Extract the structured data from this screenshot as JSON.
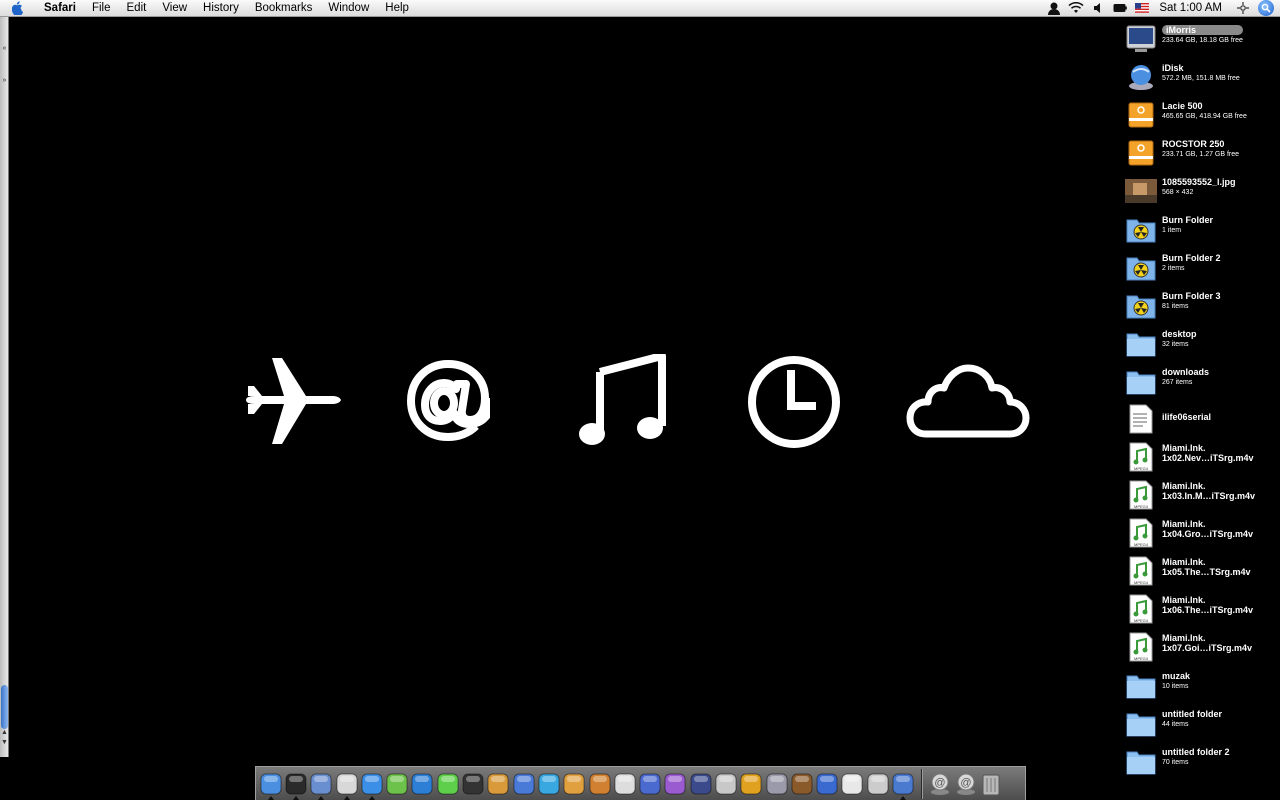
{
  "menubar": {
    "app": "Safari",
    "menus": [
      "File",
      "Edit",
      "View",
      "History",
      "Bookmarks",
      "Window",
      "Help"
    ],
    "clock": "Sat 1:00 AM"
  },
  "hero_icons": [
    "airplane-icon",
    "at-sign-icon",
    "music-note-icon",
    "clock-icon",
    "cloud-icon"
  ],
  "desktop": {
    "items": [
      {
        "name": "iMorris",
        "info": "233.64 GB, 18.18 GB free",
        "icon": "hard-drive-icon",
        "selected": true
      },
      {
        "name": "iDisk",
        "info": "572.2 MB, 151.8 MB free",
        "icon": "idisk-icon"
      },
      {
        "name": "Lacie 500",
        "info": "465.65 GB, 418.94 GB free",
        "icon": "external-drive-icon"
      },
      {
        "name": "ROCSTOR 250",
        "info": "233.71 GB, 1.27 GB free",
        "icon": "external-drive-icon"
      },
      {
        "name": "1085593552_l.jpg",
        "info": "568 × 432",
        "icon": "photo-thumbnail-icon"
      },
      {
        "name": "Burn Folder",
        "info": "1 item",
        "icon": "burn-folder-icon"
      },
      {
        "name": "Burn Folder 2",
        "info": "2 items",
        "icon": "burn-folder-icon"
      },
      {
        "name": "Burn Folder 3",
        "info": "81 items",
        "icon": "burn-folder-icon"
      },
      {
        "name": "desktop",
        "info": "32 items",
        "icon": "folder-icon"
      },
      {
        "name": "downloads",
        "info": "267 items",
        "icon": "folder-icon"
      },
      {
        "name": "ilife06serial",
        "info": "",
        "icon": "text-document-icon"
      },
      {
        "name": "Miami.Ink.",
        "name2": "1x02.Nev…iTSrg.m4v",
        "info": "",
        "icon": "mpeg4-file-icon"
      },
      {
        "name": "Miami.Ink.",
        "name2": "1x03.In.M…iTSrg.m4v",
        "info": "",
        "icon": "mpeg4-file-icon"
      },
      {
        "name": "Miami.Ink.",
        "name2": "1x04.Gro…iTSrg.m4v",
        "info": "",
        "icon": "mpeg4-file-icon"
      },
      {
        "name": "Miami.Ink.",
        "name2": "1x05.The…TSrg.m4v",
        "info": "",
        "icon": "mpeg4-file-icon"
      },
      {
        "name": "Miami.Ink.",
        "name2": "1x06.The…iTSrg.m4v",
        "info": "",
        "icon": "mpeg4-file-icon"
      },
      {
        "name": "Miami.Ink.",
        "name2": "1x07.Goi…iTSrg.m4v",
        "info": "",
        "icon": "mpeg4-file-icon"
      },
      {
        "name": "muzak",
        "info": "10 items",
        "icon": "folder-icon"
      },
      {
        "name": "untitled folder",
        "info": "44 items",
        "icon": "folder-icon"
      },
      {
        "name": "untitled folder 2",
        "info": "70 items",
        "icon": "folder-icon"
      }
    ]
  },
  "dock": {
    "apps": [
      {
        "icon": "finder-icon",
        "color": "#4a8fe0",
        "running": true
      },
      {
        "icon": "dashboard-icon",
        "color": "#2a2a2a",
        "running": true
      },
      {
        "icon": "preview-icon",
        "color": "#6a8fd0",
        "running": true
      },
      {
        "icon": "textedit-icon",
        "color": "#d8d8d8",
        "running": true
      },
      {
        "icon": "safari-icon",
        "color": "#3b8fe6",
        "running": true
      },
      {
        "icon": "itunes-icon",
        "color": "#6cc24a",
        "running": false
      },
      {
        "icon": "word-icon",
        "color": "#2d7fd6",
        "running": false
      },
      {
        "icon": "adium-icon",
        "color": "#5ecf4a",
        "running": false
      },
      {
        "icon": "camera-icon",
        "color": "#333333",
        "running": false
      },
      {
        "icon": "iphoto-icon",
        "color": "#d89a3a",
        "running": false
      },
      {
        "icon": "imovie-icon",
        "color": "#4a7ad8",
        "running": false
      },
      {
        "icon": "idvd-icon",
        "color": "#3aa8e0",
        "running": false
      },
      {
        "icon": "iweb-icon",
        "color": "#e0a040",
        "running": false
      },
      {
        "icon": "garageband-icon",
        "color": "#d08030",
        "running": false
      },
      {
        "icon": "clapper-icon",
        "color": "#dddddd",
        "running": false
      },
      {
        "icon": "quicktime-icon",
        "color": "#4a6ad0",
        "running": false
      },
      {
        "icon": "dvd-player-icon",
        "color": "#9a5ad0",
        "running": false
      },
      {
        "icon": "globe-icon",
        "color": "#3a4a8a",
        "running": false
      },
      {
        "icon": "mail-icon",
        "color": "#c8c8c8",
        "running": false
      },
      {
        "icon": "fruit-icon",
        "color": "#e0a020",
        "running": false
      },
      {
        "icon": "system-preferences-icon",
        "color": "#9a9aaa",
        "running": false
      },
      {
        "icon": "cookie-icon",
        "color": "#8a5a2a",
        "running": false
      },
      {
        "icon": "bluetooth-icon",
        "color": "#3a6ad0",
        "running": false
      },
      {
        "icon": "ipod-icon",
        "color": "#e8e8e8",
        "running": false
      },
      {
        "icon": "utility-icon",
        "color": "#cccccc",
        "running": false
      },
      {
        "icon": "photos-stack-icon",
        "color": "#4a7ad0",
        "running": true
      }
    ],
    "docs": [
      {
        "icon": "at-stack-icon",
        "color": "#bbbbbb"
      },
      {
        "icon": "at-stack-icon",
        "color": "#bbbbbb"
      },
      {
        "icon": "trash-icon",
        "color": "#aaaaaa"
      }
    ]
  }
}
